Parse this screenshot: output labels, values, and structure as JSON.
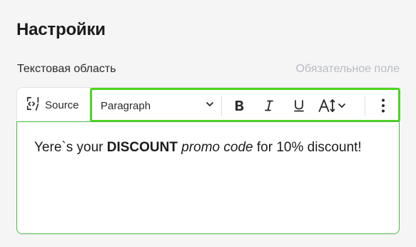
{
  "page": {
    "title": "Настройки"
  },
  "field": {
    "label": "Текстовая область",
    "required_hint": "Обязательное поле"
  },
  "toolbar": {
    "source_label": "Source",
    "block_format": "Paragraph",
    "buttons": {
      "bold": "bold-icon",
      "italic": "italic-icon",
      "underline": "underline-icon",
      "font_size": "text-size-icon",
      "more": "more-vertical-icon"
    },
    "highlight_color": "#4cd51f"
  },
  "editor": {
    "text_before": "Yere`s your ",
    "bold_text": "DISCOUNT",
    "text_space": " ",
    "italic_text": "promo code",
    "text_after": " for 10% discount!",
    "border_color": "#4cb84a"
  }
}
